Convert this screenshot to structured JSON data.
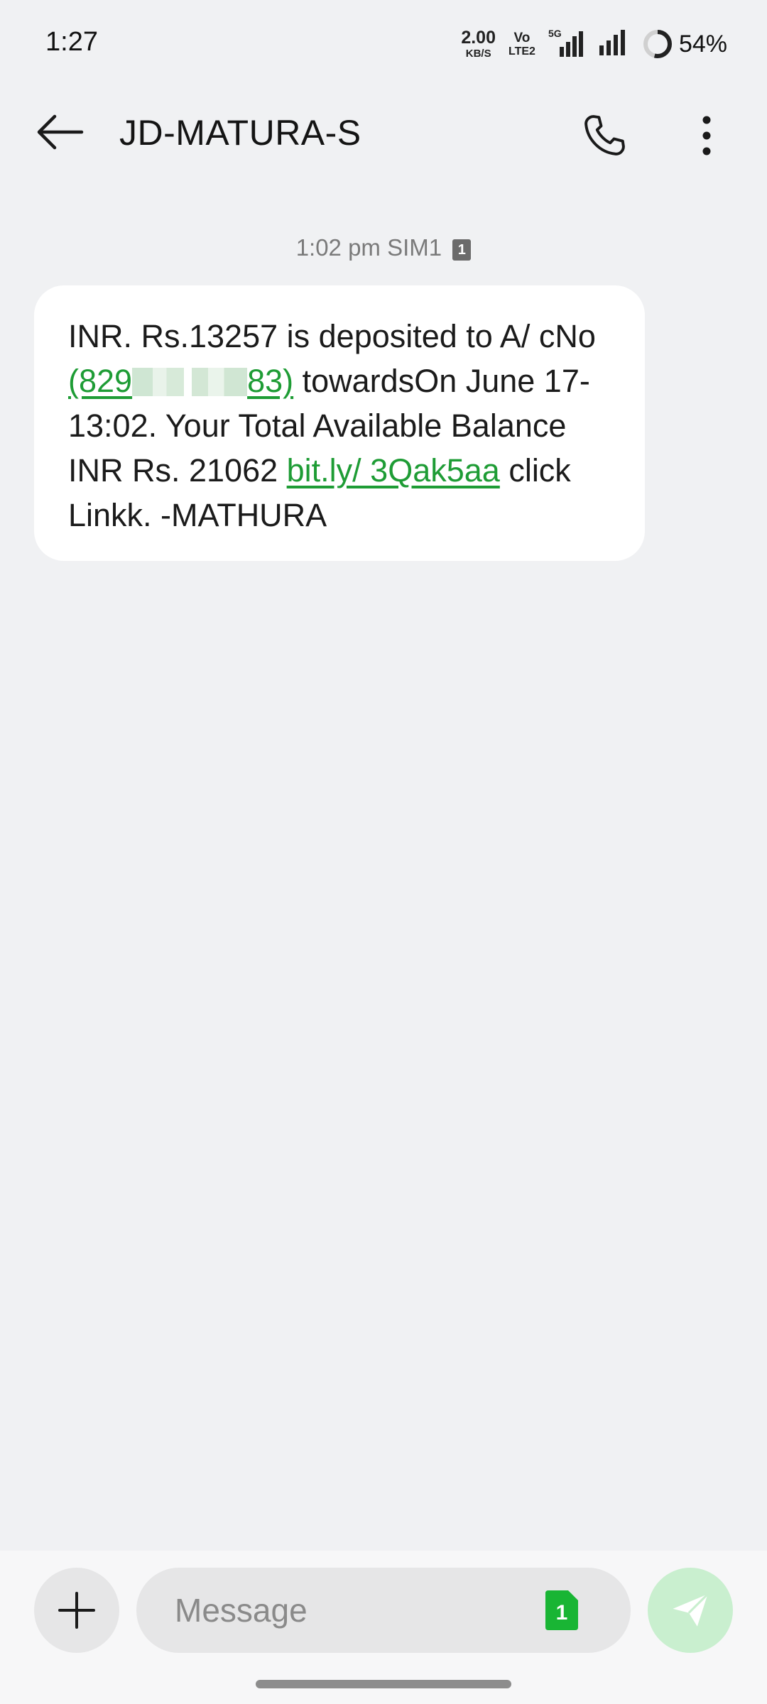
{
  "status_bar": {
    "time": "1:27",
    "net_speed_value": "2.00",
    "net_speed_unit": "KB/S",
    "volte_top": "Vo",
    "volte_bottom": "LTE2",
    "network_tag": "5G",
    "battery_percent": "54%",
    "battery_level": 0.54
  },
  "header": {
    "contact_name": "JD-MATURA-S",
    "back_icon": "arrow-left-icon",
    "call_icon": "phone-icon",
    "more_icon": "more-vertical-icon"
  },
  "conversation": {
    "meta_time": "1:02 pm",
    "meta_sim": "SIM1",
    "meta_sim_badge": "1",
    "message": {
      "part1": "INR. Rs.13257 is deposited to A/ cNo ",
      "account_prefix": "(829",
      "account_suffix": "83)",
      "part2": " towardsOn June 17-13:02. Your Total Available Balance INR Rs. 21062 ",
      "link": "bit.ly/ 3Qak5aa",
      "part3": " click Linkk. -MATHURA"
    }
  },
  "composer": {
    "placeholder": "Message",
    "sim_number": "1",
    "add_icon": "plus-icon",
    "send_icon": "send-icon"
  },
  "colors": {
    "background": "#f0f1f3",
    "bubble": "#ffffff",
    "link": "#1e9c35",
    "sim_chip": "#19b534",
    "send_disabled": "#c9efcf"
  }
}
